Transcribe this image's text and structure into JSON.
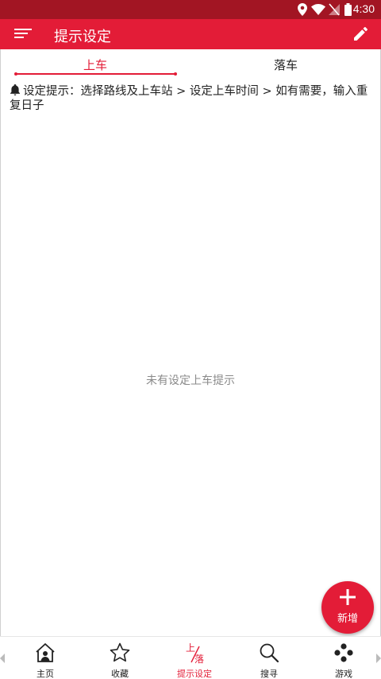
{
  "status_bar": {
    "time": "4:30",
    "icons": [
      "location-icon",
      "wifi-icon",
      "no-signal-icon",
      "battery-icon"
    ]
  },
  "app_bar": {
    "title": "提示设定",
    "menu_icon": "menu-icon",
    "edit_icon": "edit-icon"
  },
  "tabs": [
    {
      "label": "上车",
      "active": true
    },
    {
      "label": "落车",
      "active": false
    }
  ],
  "hint": {
    "icon": "bell-icon",
    "text": "设定提示：选择路线及上车站 > 设定上车时间 > 如有需要，输入重复日子"
  },
  "empty_message": "未有设定上车提示",
  "fab": {
    "icon": "plus-icon",
    "label": "新增"
  },
  "bottom_nav": [
    {
      "label": "主页",
      "icon": "home-icon",
      "active": false
    },
    {
      "label": "收藏",
      "icon": "star-icon",
      "active": false
    },
    {
      "label": "提示设定",
      "icon": "board-alight-icon",
      "icon_text_top": "上",
      "icon_text_bottom": "落",
      "active": true
    },
    {
      "label": "搜寻",
      "icon": "search-icon",
      "active": false
    },
    {
      "label": "游戏",
      "icon": "game-icon",
      "active": false
    }
  ],
  "colors": {
    "status_bar": "#a21523",
    "primary": "#e31c37",
    "text": "#222222",
    "muted": "#8a8a8a"
  }
}
